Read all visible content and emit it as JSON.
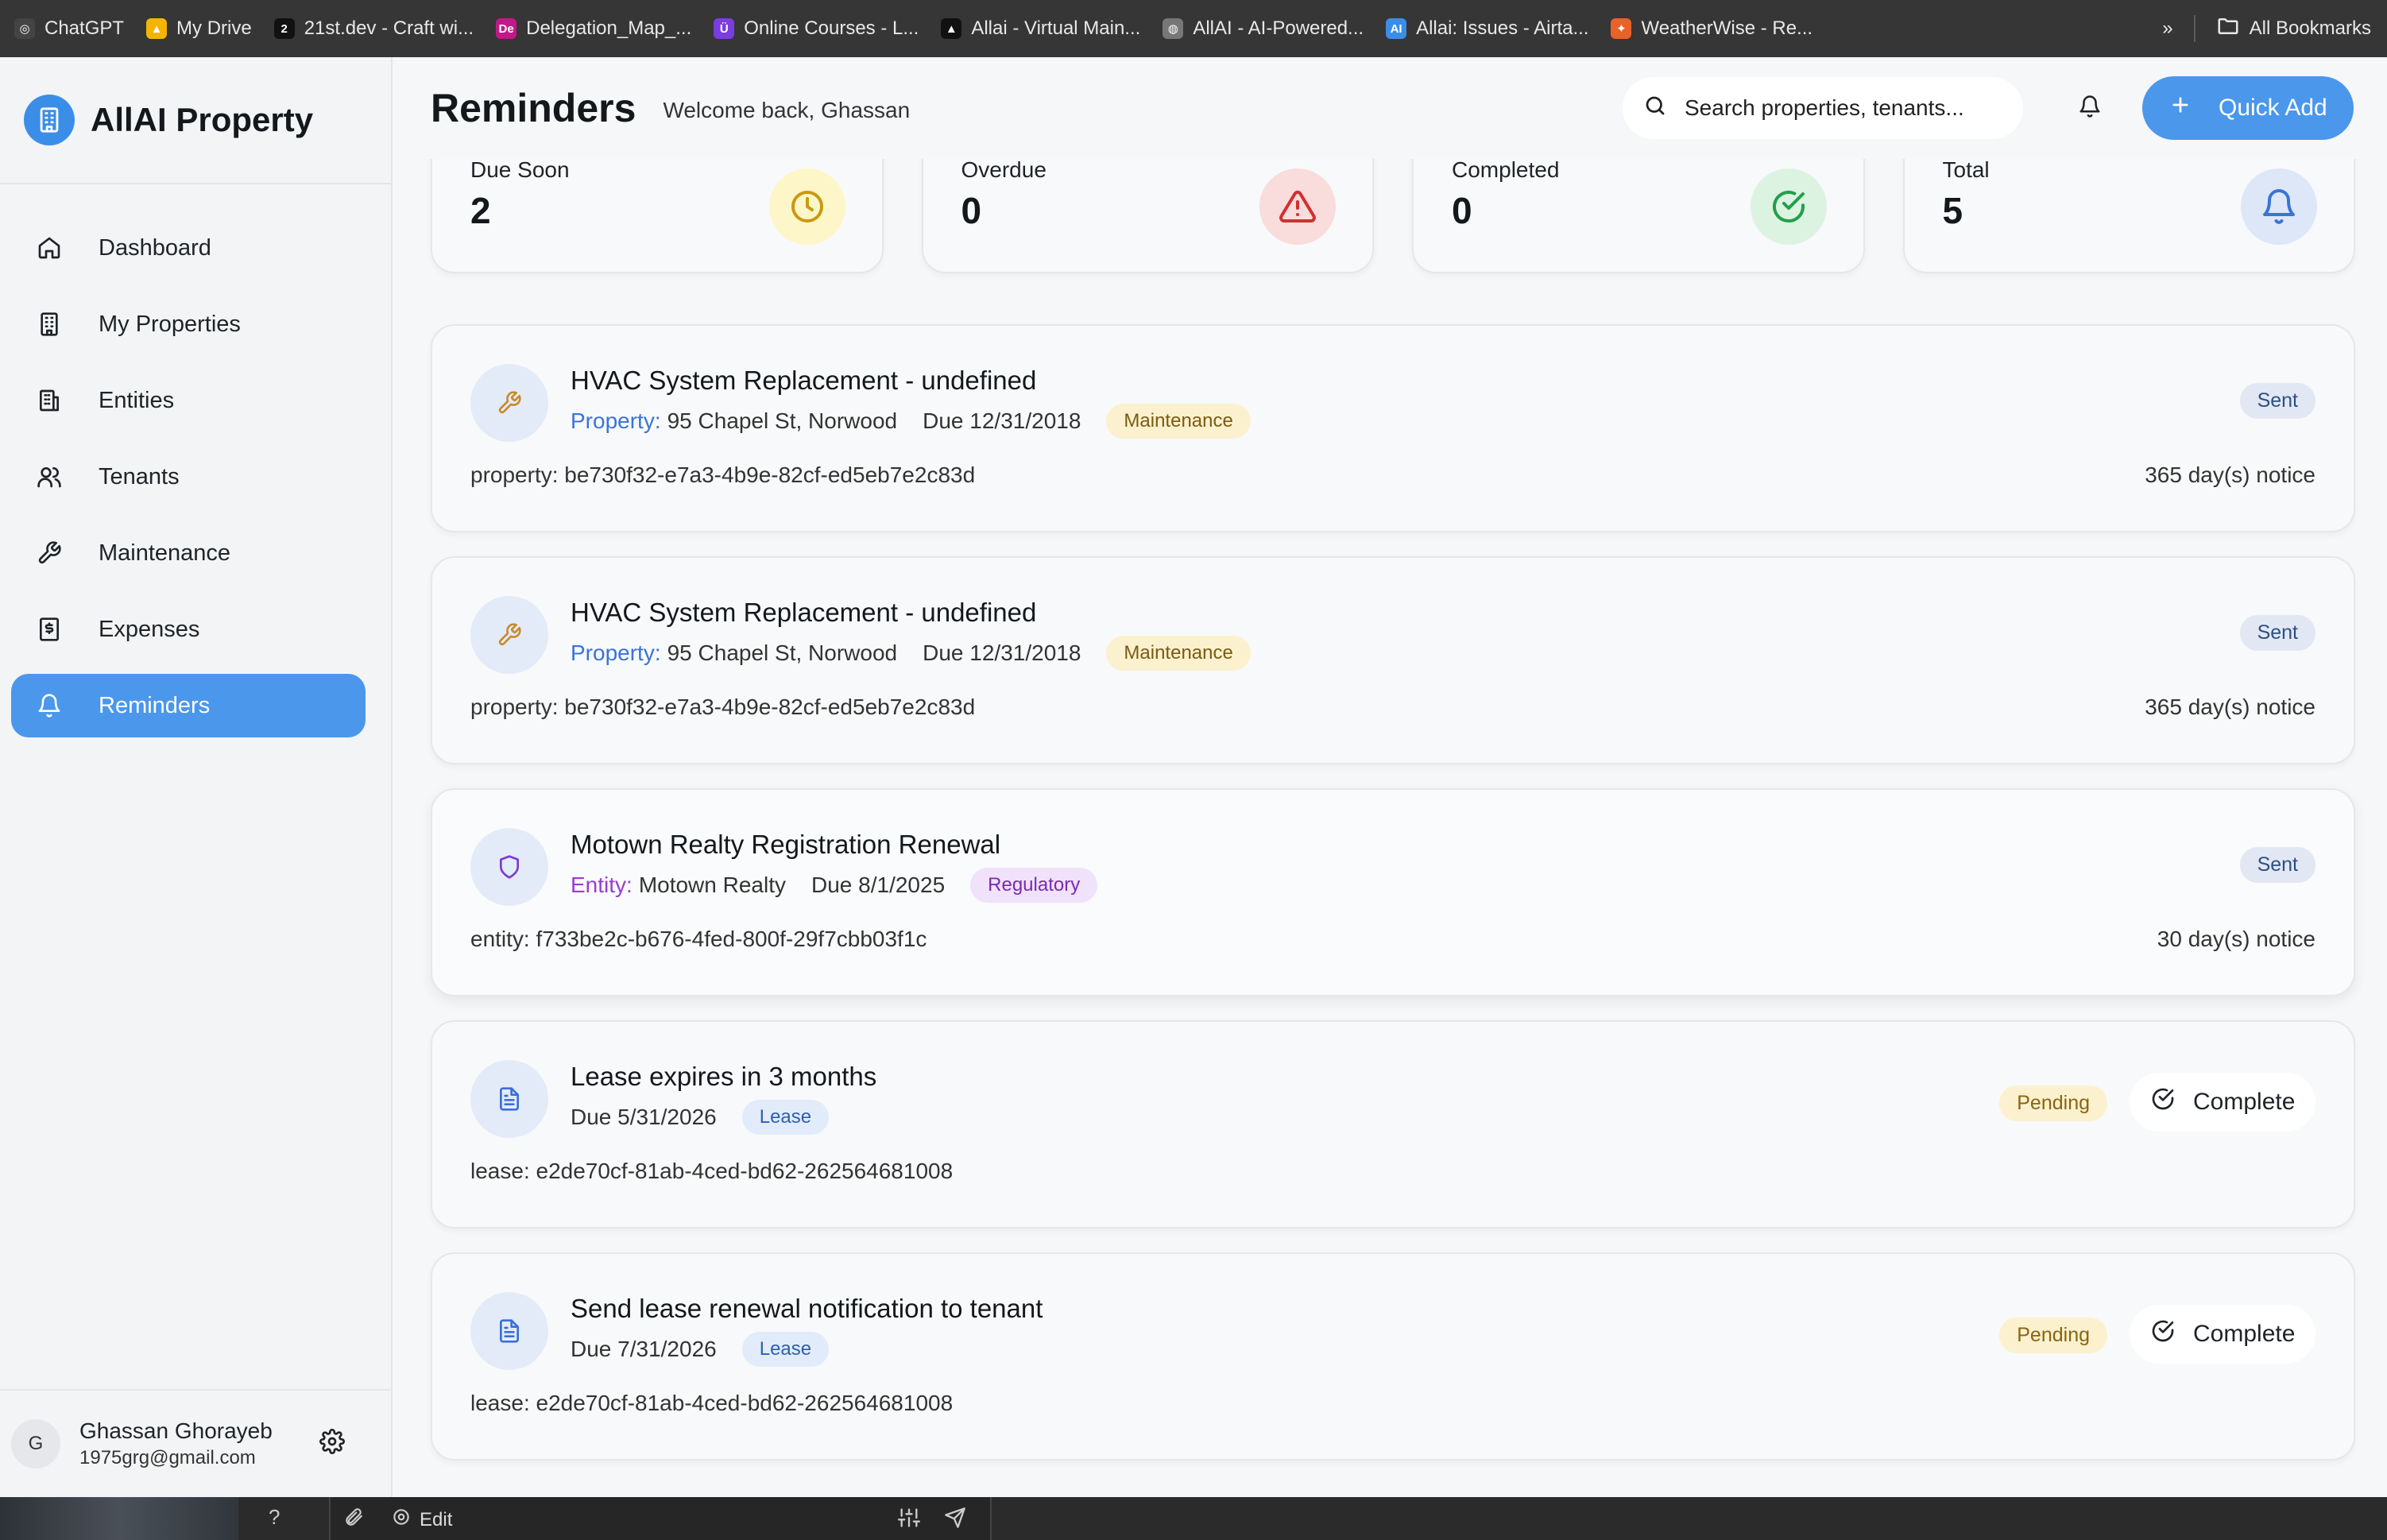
{
  "bookmarks": [
    {
      "label": "ChatGPT",
      "icon": "chatgpt-icon",
      "color": "#444444",
      "glyph": "◎"
    },
    {
      "label": "My Drive",
      "icon": "google-drive-icon",
      "color": "#f4b400",
      "glyph": "▲"
    },
    {
      "label": "21st.dev - Craft wi...",
      "icon": "21st-dev-icon",
      "color": "#111111",
      "glyph": "2"
    },
    {
      "label": "Delegation_Map_...",
      "icon": "delegation-icon",
      "color": "#c2188a",
      "glyph": "De"
    },
    {
      "label": "Online Courses - L...",
      "icon": "courses-icon",
      "color": "#7a3de0",
      "glyph": "Ü"
    },
    {
      "label": "Allai - Virtual Main...",
      "icon": "allai-virtual-icon",
      "color": "#111111",
      "glyph": "▲"
    },
    {
      "label": "AllAI - AI-Powered...",
      "icon": "globe-icon",
      "color": "#777777",
      "glyph": "◍"
    },
    {
      "label": "Allai: Issues - Airta...",
      "icon": "airtable-icon",
      "color": "#3b8ee8",
      "glyph": "AI"
    },
    {
      "label": "WeatherWise - Re...",
      "icon": "weatherwise-icon",
      "color": "#e8622a",
      "glyph": "✦"
    }
  ],
  "bookmarks_overflow": "»",
  "all_bookmarks": "All Bookmarks",
  "brand": {
    "title": "AllAI Property"
  },
  "nav": [
    {
      "label": "Dashboard",
      "icon": "home-icon"
    },
    {
      "label": "My Properties",
      "icon": "building-icon"
    },
    {
      "label": "Entities",
      "icon": "entities-icon"
    },
    {
      "label": "Tenants",
      "icon": "users-icon"
    },
    {
      "label": "Maintenance",
      "icon": "wrench-icon"
    },
    {
      "label": "Expenses",
      "icon": "dollar-receipt-icon"
    },
    {
      "label": "Reminders",
      "icon": "bell-icon",
      "active": true
    }
  ],
  "user": {
    "initial": "G",
    "name": "Ghassan Ghorayeb",
    "email": "1975grg@gmail.com"
  },
  "header": {
    "title": "Reminders",
    "welcome": "Welcome back, Ghassan",
    "search_placeholder": "Search properties, tenants...",
    "quick_add": "Quick Add"
  },
  "stats": [
    {
      "label": "Due Soon",
      "value": "2",
      "icon": "clock-icon",
      "bg": "#fdf6c9",
      "fg": "#c99a10"
    },
    {
      "label": "Overdue",
      "value": "0",
      "icon": "warning-icon",
      "bg": "#f9dcdc",
      "fg": "#d23030"
    },
    {
      "label": "Completed",
      "value": "0",
      "icon": "check-circle-icon",
      "bg": "#dcf3e2",
      "fg": "#22a04a"
    },
    {
      "label": "Total",
      "value": "5",
      "icon": "bell-icon",
      "bg": "#dde7f7",
      "fg": "#3a74d6"
    }
  ],
  "reminders": [
    {
      "title": "HVAC System Replacement - undefined",
      "icon": "wrench-icon",
      "ref_key": "Property:",
      "ref_kind": "property",
      "ref_value": "95 Chapel St, Norwood",
      "due": "Due 12/31/2018",
      "tag": "Maintenance",
      "tag_kind": "maint",
      "detail": "property: be730f32-e7a3-4b9e-82cf-ed5eb7e2c83d",
      "notice": "365 day(s) notice",
      "status": "Sent"
    },
    {
      "title": "HVAC System Replacement - undefined",
      "icon": "wrench-icon",
      "ref_key": "Property:",
      "ref_kind": "property",
      "ref_value": "95 Chapel St, Norwood",
      "due": "Due 12/31/2018",
      "tag": "Maintenance",
      "tag_kind": "maint",
      "detail": "property: be730f32-e7a3-4b9e-82cf-ed5eb7e2c83d",
      "notice": "365 day(s) notice",
      "status": "Sent"
    },
    {
      "title": "Motown Realty Registration Renewal",
      "icon": "shield-icon",
      "ref_key": "Entity:",
      "ref_kind": "entity",
      "ref_value": "Motown Realty",
      "due": "Due 8/1/2025",
      "tag": "Regulatory",
      "tag_kind": "reg",
      "detail": "entity: f733be2c-b676-4fed-800f-29f7cbb03f1c",
      "notice": "30 day(s) notice",
      "status": "Sent",
      "highlight": true
    },
    {
      "title": "Lease expires in 3 months",
      "icon": "document-icon",
      "due": "Due 5/31/2026",
      "tag": "Lease",
      "tag_kind": "lease",
      "detail": "lease: e2de70cf-81ab-4ced-bd62-262564681008",
      "status": "Pending",
      "action": "Complete"
    },
    {
      "title": "Send lease renewal notification to tenant",
      "icon": "document-icon",
      "due": "Due 7/31/2026",
      "tag": "Lease",
      "tag_kind": "lease",
      "detail": "lease: e2de70cf-81ab-4ced-bd62-262564681008",
      "status": "Pending",
      "action": "Complete"
    }
  ],
  "bottom_bar": {
    "help": "?",
    "edit": "Edit"
  }
}
